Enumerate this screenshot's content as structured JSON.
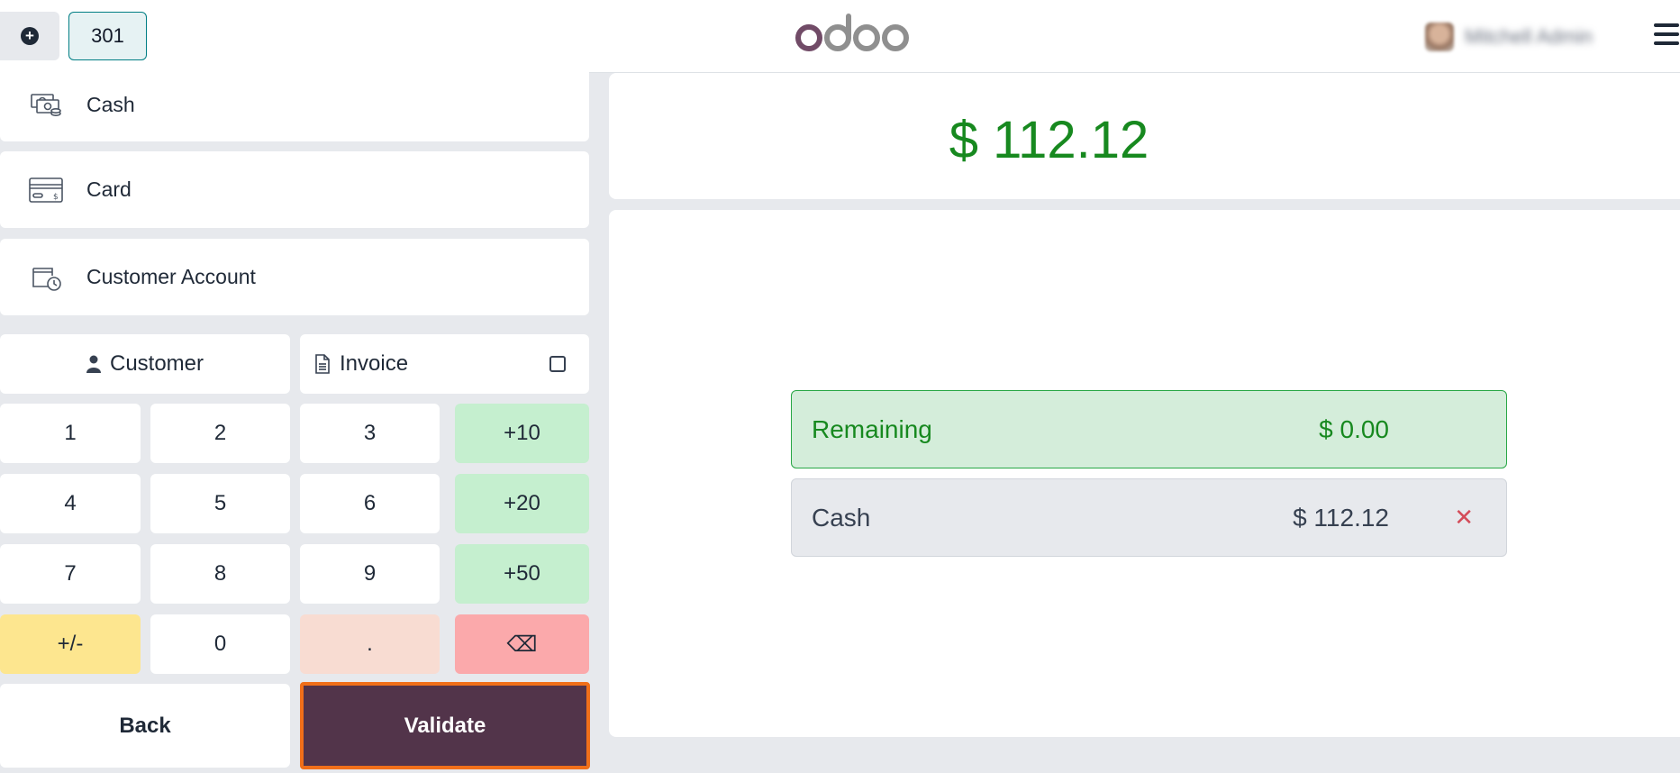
{
  "topbar": {
    "order_tab_label": "301",
    "user_name": "Mitchell Admin",
    "logo_text": "odoo"
  },
  "payment_methods": [
    {
      "label": "Cash",
      "icon": "cash-icon"
    },
    {
      "label": "Card",
      "icon": "card-icon"
    },
    {
      "label": "Customer Account",
      "icon": "customer-account-icon"
    }
  ],
  "actions": {
    "customer_label": "Customer",
    "invoice_label": "Invoice",
    "invoice_checked": false
  },
  "numpad": {
    "k1": "1",
    "k2": "2",
    "k3": "3",
    "plus10": "+10",
    "k4": "4",
    "k5": "5",
    "k6": "6",
    "plus20": "+20",
    "k7": "7",
    "k8": "8",
    "k9": "9",
    "plus50": "+50",
    "sign": "+/-",
    "k0": "0",
    "decimal": ".",
    "backspace": "⌫"
  },
  "footer": {
    "back_label": "Back",
    "validate_label": "Validate"
  },
  "summary": {
    "total": "$ 112.12",
    "remaining_label": "Remaining",
    "remaining_amount": "$ 0.00",
    "payment_lines": [
      {
        "method": "Cash",
        "amount": "$ 112.12"
      }
    ]
  },
  "colors": {
    "brand_purple": "#714b67",
    "validate_bg": "#52344a",
    "validate_border": "#f06f1a",
    "success_green": "#17891f",
    "teal_accent": "#017e84"
  }
}
